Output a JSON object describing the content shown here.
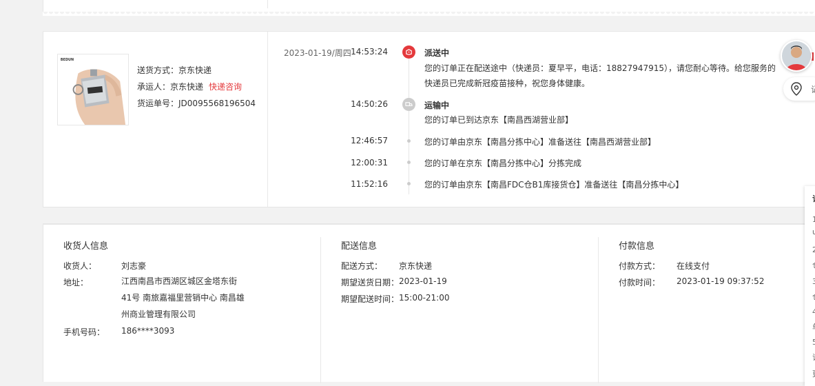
{
  "product": {
    "shipping_method_label": "送货方式：",
    "shipping_method": "京东快递",
    "carrier_label": "承运人：",
    "carrier": "京东快递",
    "courier_inquiry": "快递咨询",
    "waybill_label": "货运单号：",
    "waybill_no": "JD0095568196504",
    "image_brand": "BEDUN"
  },
  "tracking": {
    "date": "2023-01-19/周四",
    "events": [
      {
        "time": "14:53:24",
        "title": "派送中",
        "text": "您的订单正在配送途中（快递员：夏早平，电话：18827947915），请您耐心等待。给您服务的快递员已完成新冠疫苗接种，祝您身体健康。",
        "icon": "delivery-icon",
        "color": "#e4393c"
      },
      {
        "time": "14:50:26",
        "title": "运输中",
        "text": "您的订单已到达京东【南昌西湖营业部】",
        "icon": "truck-icon",
        "color": "#cccccc"
      },
      {
        "time": "12:46:57",
        "title": "",
        "text": "您的订单由京东【南昌分拣中心】准备送往【南昌西湖营业部】"
      },
      {
        "time": "12:00:31",
        "title": "",
        "text": "您的订单在京东【南昌分拣中心】分拣完成"
      },
      {
        "time": "11:52:16",
        "title": "",
        "text": "您的订单由京东【南昌FDC仓B1库接货仓】准备送往【南昌分拣中心】"
      }
    ]
  },
  "consignee": {
    "heading": "收货人信息",
    "name_label": "收货人：",
    "name": "刘志豪",
    "address_label": "地址：",
    "address_lines": [
      "江西南昌市西湖区城区金塔东街",
      "41号 南旅嘉福里营销中心 南昌雄",
      "州商业管理有限公司"
    ],
    "phone_label": "手机号码：",
    "phone": "186****3093"
  },
  "delivery": {
    "heading": "配送信息",
    "method_label": "配送方式：",
    "method": "京东快递",
    "date_label": "期望送货日期：",
    "date": "2023-01-19",
    "time_label": "期望配送时间：",
    "time": "15:00-21:00"
  },
  "payment": {
    "heading": "付款信息",
    "method_label": "付款方式：",
    "method": "在线支付",
    "time_label": "付款时间：",
    "time": "2023-01-19 09:37:52"
  },
  "sidebar": {
    "location_peek": "记",
    "panel_peek": [
      "订",
      "1",
      "u",
      "2",
      "仓",
      "3",
      "仓",
      "4",
      "单",
      "5",
      "订",
      "更"
    ]
  },
  "colors": {
    "accent": "#e4393c",
    "text": "#333333",
    "muted": "#666666",
    "border": "#e6e6e6"
  }
}
